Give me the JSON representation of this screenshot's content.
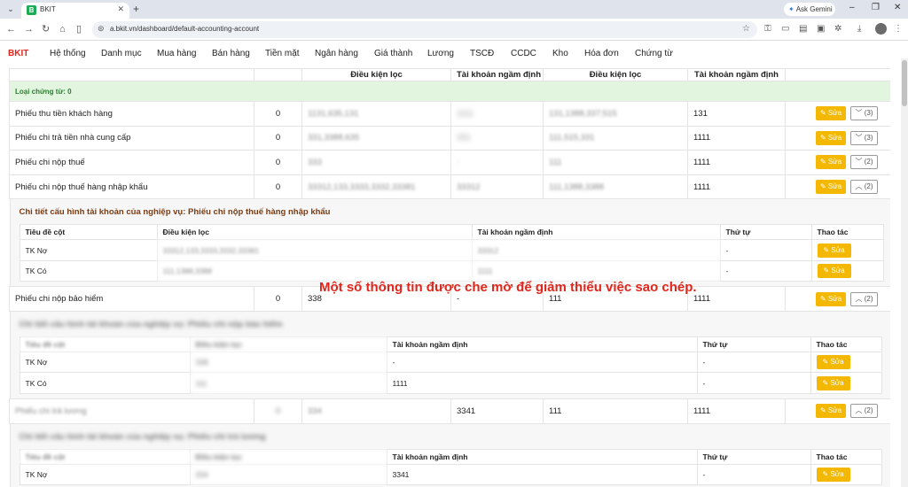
{
  "browser": {
    "tab_title": "BKIT",
    "tab_favicon_letter": "B",
    "url": "a.bkit.vn/dashboard/default-accounting-account",
    "gemini_label": "Ask Gemini"
  },
  "app": {
    "brand": "BKIT",
    "menu": [
      "Hệ thống",
      "Danh mục",
      "Mua hàng",
      "Bán hàng",
      "Tiền mặt",
      "Ngân hàng",
      "Giá thành",
      "Lương",
      "TSCĐ",
      "CCDC",
      "Kho",
      "Hóa đơn",
      "Chứng từ"
    ]
  },
  "table": {
    "headers": [
      "",
      "",
      "Điều kiện lọc",
      "Tài khoản ngầm định",
      "Điều kiện lọc",
      "Tài khoản ngầm định",
      ""
    ],
    "group_label": "Loại chứng từ: 0",
    "edit_label": "Sửa",
    "rows": [
      {
        "name": "Phiếu thu tiền khách hàng",
        "count": "0",
        "filter1": "1131,635,131",
        "account1": "1111",
        "filter2": "131,1388,337;515",
        "account2": "131",
        "toggle": "(3)",
        "toggle_dir": "down"
      },
      {
        "name": "Phiếu chi trả tiền nhà cung cấp",
        "count": "0",
        "filter1": "331,3388,635",
        "account1": "331",
        "filter2": "111,515,331",
        "account2": "1111",
        "toggle": "(3)",
        "toggle_dir": "down"
      },
      {
        "name": "Phiếu chi nộp thuế",
        "count": "0",
        "filter1": "333",
        "account1": "-",
        "filter2": "111",
        "account2": "1111",
        "toggle": "(2)",
        "toggle_dir": "down"
      },
      {
        "name": "Phiếu chi nộp thuế hàng nhập khẩu",
        "count": "0",
        "filter1": "33312,133,3333,3332,33381",
        "account1": "33312",
        "filter2": "111,1388,3388",
        "account2": "1111",
        "toggle": "(2)",
        "toggle_dir": "up"
      },
      {
        "name": "Phiếu chi nộp bảo hiểm",
        "count": "0",
        "filter1": "338",
        "account1": "-",
        "filter2": "111",
        "account2": "1111",
        "toggle": "(2)",
        "toggle_dir": "up"
      },
      {
        "name": "Phiếu chi trả lương",
        "count": "0",
        "filter1": "334",
        "account1": "3341",
        "filter2": "111",
        "account2": "1111",
        "toggle": "(2)",
        "toggle_dir": "up"
      }
    ]
  },
  "detail_headers": [
    "Tiêu đề cột",
    "Điều kiện lọc",
    "Tài khoản ngầm định",
    "Thứ tự",
    "Thao tác"
  ],
  "details": [
    {
      "title": "Chi tiết cấu hình tài khoản của nghiệp vụ: Phiếu chi nộp thuế hàng nhập khẩu",
      "rows": [
        {
          "col": "TK Nợ",
          "filter": "33312,133,3333,3332,33381",
          "account": "33312",
          "order": "-"
        },
        {
          "col": "TK Có",
          "filter": "111,1388,3388",
          "account": "1111",
          "order": "-"
        }
      ]
    },
    {
      "title": "Chi tiết cấu hình tài khoản của nghiệp vụ: Phiếu chi nộp bảo hiểm",
      "rows": [
        {
          "col": "TK Nợ",
          "filter": "338",
          "account": "-",
          "order": "-"
        },
        {
          "col": "TK Có",
          "filter": "111",
          "account": "1111",
          "order": "-"
        }
      ]
    },
    {
      "title": "Chi tiết cấu hình tài khoản của nghiệp vụ: Phiếu chi trả lương",
      "rows": [
        {
          "col": "TK Nợ",
          "filter": "334",
          "account": "3341",
          "order": "-"
        }
      ]
    }
  ],
  "watermark": "Một số thông tin được che mờ để giảm thiểu việc sao chép."
}
